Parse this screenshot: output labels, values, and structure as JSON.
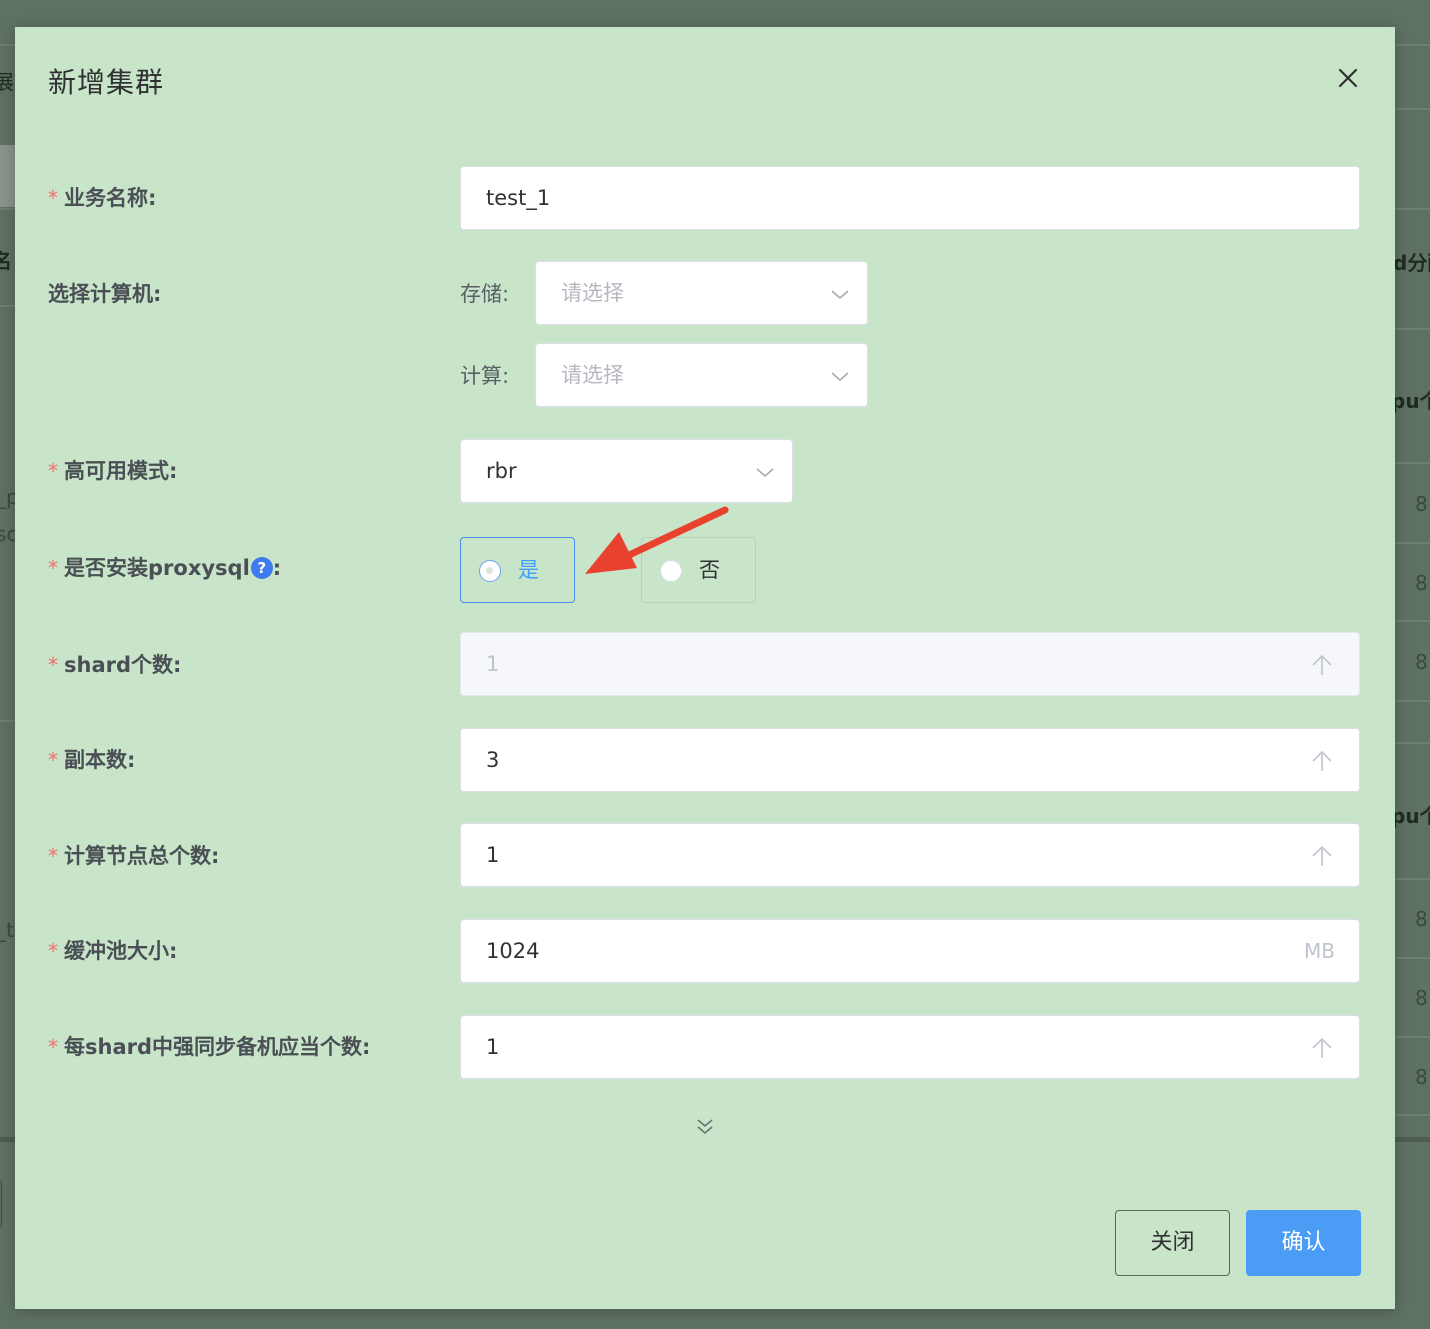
{
  "dialog": {
    "title": "新增集群",
    "close_icon": "close-icon"
  },
  "form": {
    "business_name": {
      "label": "业务名称:",
      "required": "*",
      "value": "test_1"
    },
    "select_machine": {
      "label": "选择计算机:",
      "storage": {
        "label": "存储:",
        "placeholder": "请选择"
      },
      "compute": {
        "label": "计算:",
        "placeholder": "请选择"
      }
    },
    "ha_mode": {
      "label": "高可用模式:",
      "required": "*",
      "value": "rbr"
    },
    "install_proxysql": {
      "label": "是否安装proxysql",
      "label_suffix": ":",
      "required": "*",
      "help_icon": "?",
      "options": [
        {
          "label": "是",
          "checked": true
        },
        {
          "label": "否",
          "checked": false
        }
      ]
    },
    "shard_count": {
      "label": "shard个数:",
      "required": "*",
      "value": "1",
      "disabled": true
    },
    "replica_count": {
      "label": "副本数:",
      "required": "*",
      "value": "3"
    },
    "compute_nodes": {
      "label": "计算节点总个数:",
      "required": "*",
      "value": "1"
    },
    "buffer_pool": {
      "label": "缓冲池大小:",
      "required": "*",
      "value": "1024",
      "unit": "MB"
    },
    "sync_standby": {
      "label": "每shard中强同步备机应当个数:",
      "required": "*",
      "value": "1"
    }
  },
  "footer": {
    "close_label": "关闭",
    "confirm_label": "确认"
  },
  "background": {
    "fragments": [
      "展",
      "名",
      "d分配",
      "pu个",
      "_p",
      "sc",
      "8",
      "8",
      "8",
      "pu个",
      "_te",
      "8",
      "8",
      "8"
    ]
  },
  "colors": {
    "dialog_bg": "#c8e4c9",
    "mask": "#5f7262",
    "primary": "#409eff",
    "required": "#f56c6c",
    "annotation_arrow": "#e8422e"
  }
}
